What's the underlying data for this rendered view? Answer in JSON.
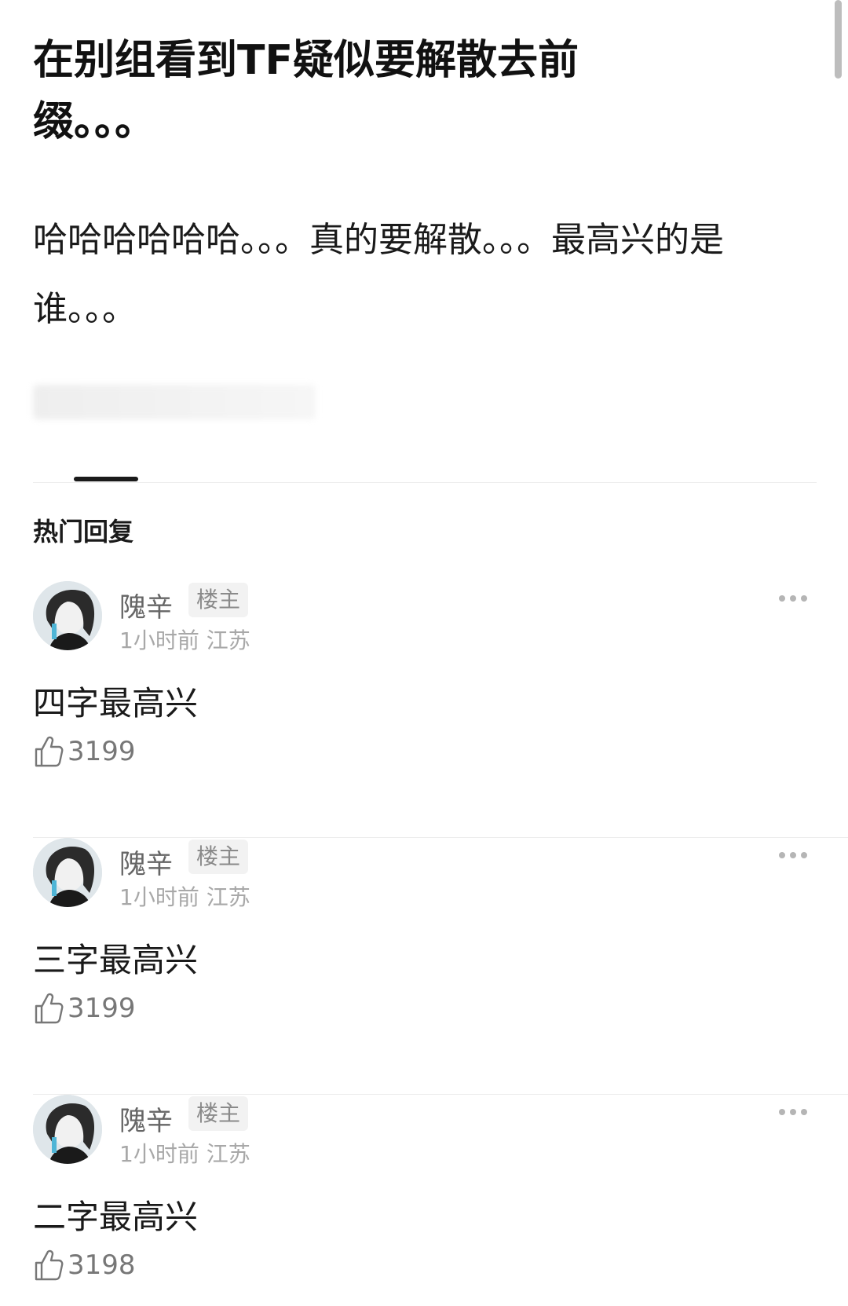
{
  "post": {
    "title": "在别组看到TF疑似要解散去前缀。。。",
    "body": "哈哈哈哈哈哈。。。真的要解散。。。最高兴的是谁。。。"
  },
  "section_title": "热门回复",
  "comments": [
    {
      "author": "隗辛",
      "badge": "楼主",
      "time": "1小时前",
      "location": "江苏",
      "text": "四字最高兴",
      "likes": "3199"
    },
    {
      "author": "隗辛",
      "badge": "楼主",
      "time": "1小时前",
      "location": "江苏",
      "text": "三字最高兴",
      "likes": "3199"
    },
    {
      "author": "隗辛",
      "badge": "楼主",
      "time": "1小时前",
      "location": "江苏",
      "text": "二字最高兴",
      "likes": "3198"
    }
  ]
}
